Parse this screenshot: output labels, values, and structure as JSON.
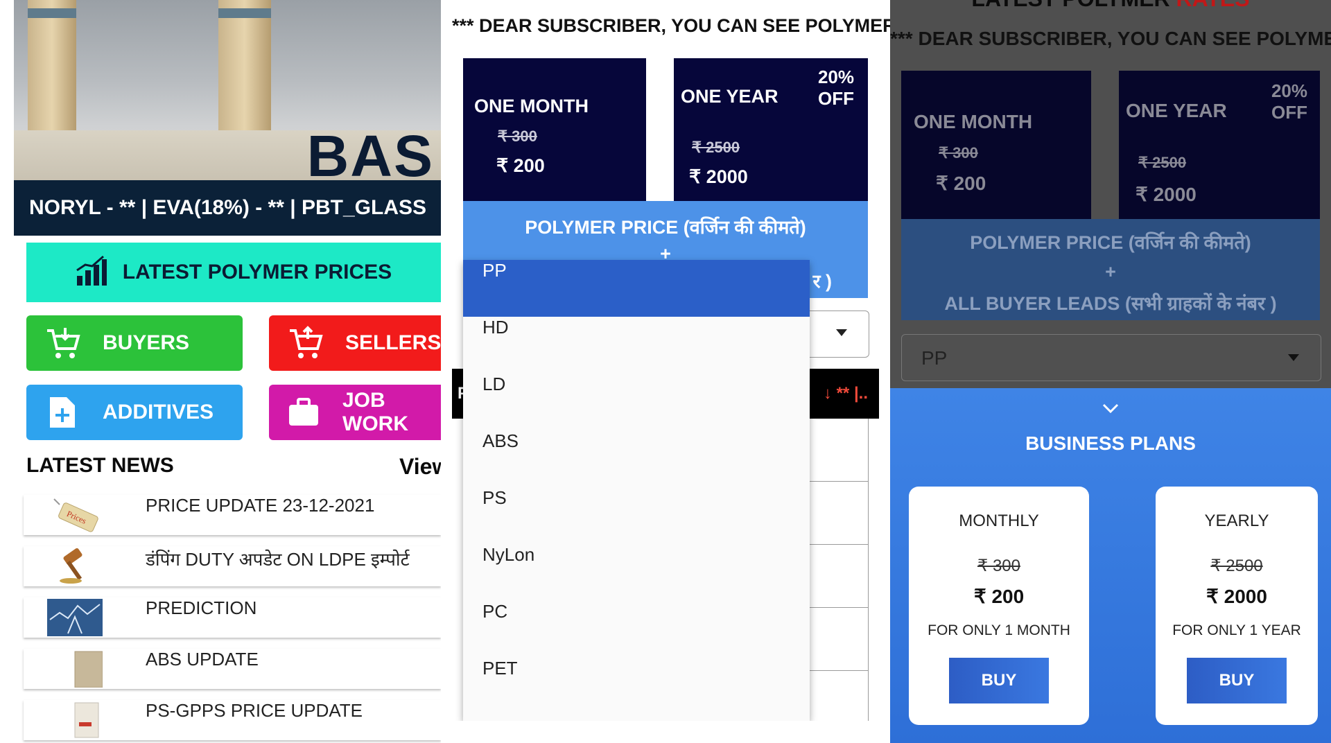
{
  "panel1": {
    "hero_logo_text": "BAS",
    "ticker": "NORYL -  ** |  EVA(18%) -  ** |  PBT_GLASS",
    "latest_prices_label": "LATEST POLYMER PRICES",
    "tiles": {
      "buyers": "BUYERS",
      "sellers": "SELLERS",
      "additives": "ADDITIVES",
      "job_work": "JOB WORK"
    },
    "colors": {
      "buyers": "#2cc23a",
      "sellers": "#f21b1b",
      "additives": "#2ea3ee",
      "job_work": "#d21aa9",
      "latest": "#1de9c6"
    },
    "news_heading": "LATEST NEWS",
    "news_view": "View",
    "news": [
      {
        "title": "PRICE UPDATE 23-12-2021",
        "icon": "price-tag-icon"
      },
      {
        "title": "डंपिंग DUTY अपडेट ON LDPE इम्पोर्ट",
        "icon": "gavel-icon"
      },
      {
        "title": "PREDICTION",
        "icon": "chart-thumbnail-icon"
      },
      {
        "title": "ABS UPDATE",
        "icon": "bag-icon"
      },
      {
        "title": "PS-GPPS PRICE UPDATE",
        "icon": "sack-icon"
      }
    ]
  },
  "panel2": {
    "notice": "*** DEAR SUBSCRIBER, YOU CAN SEE POLYMER..",
    "month": {
      "name": "ONE MONTH",
      "old": "₹ 300",
      "new": "₹ 200"
    },
    "year": {
      "name": "ONE YEAR",
      "old": "₹ 2500",
      "new": "₹ 2000",
      "disc1": "20%",
      "disc2": "OFF"
    },
    "poly_line1": "POLYMER PRICE (वर्जिन की कीमते)",
    "poly_plus": "+",
    "poly_tail": "र )",
    "strip_left": "P",
    "strip_right": "↓ ** |..",
    "dropdown_options": [
      "PP",
      "HD",
      "LD",
      "ABS",
      "PS",
      "NyLon",
      "PC",
      "PET"
    ],
    "selected": "PP"
  },
  "panel3": {
    "title_dark": "LATEST POLYMER",
    "title_red": "RATES",
    "notice": "*** DEAR SUBSCRIBER, YOU CAN SEE POLYMER",
    "month": {
      "name": "ONE MONTH",
      "old": "₹ 300",
      "new": "₹ 200"
    },
    "year": {
      "name": "ONE YEAR",
      "old": "₹ 2500",
      "new": "₹ 2000",
      "disc1": "20%",
      "disc2": "OFF"
    },
    "band_line1": "POLYMER PRICE (वर्जिन की कीमते)",
    "band_plus": "+",
    "band_line2": "ALL BUYER LEADS (सभी ग्राहकों के नंबर )",
    "select_value": "PP",
    "biz_title": "BUSINESS PLANS",
    "cards": [
      {
        "name": "MONTHLY",
        "old": "₹ 300",
        "price": "₹ 200",
        "desc": "FOR ONLY 1 MONTH",
        "buy": "BUY"
      },
      {
        "name": "YEARLY",
        "old": "₹ 2500",
        "price": "₹ 2000",
        "desc": "FOR ONLY 1 YEAR",
        "buy": "BUY"
      }
    ]
  }
}
